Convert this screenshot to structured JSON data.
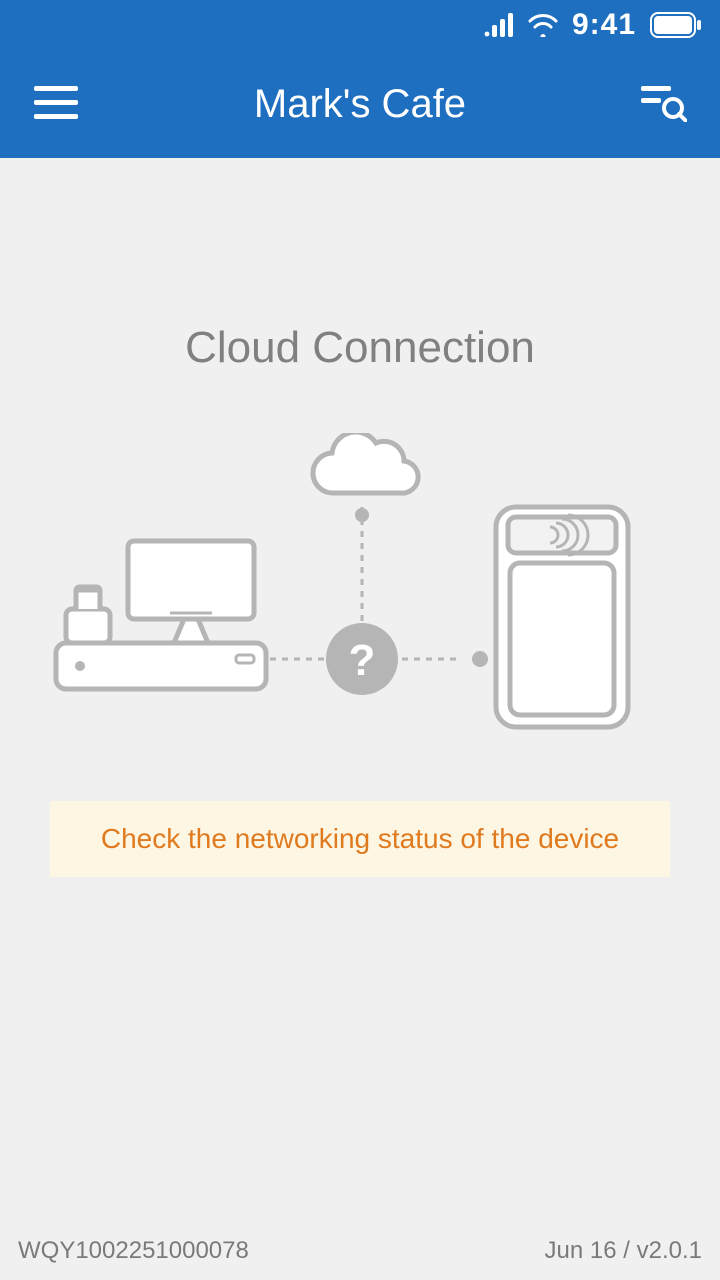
{
  "status_bar": {
    "time": "9:41"
  },
  "header": {
    "title": "Mark's Cafe"
  },
  "main": {
    "section_title": "Cloud Connection",
    "banner_text": "Check the networking status of the device",
    "center_glyph": "?"
  },
  "footer": {
    "device_id": "WQY1002251000078",
    "date_version": "Jun 16 / v2.0.1"
  },
  "colors": {
    "brand_blue": "#1e6fc0",
    "gray_text": "#808080",
    "banner_bg": "#fdf6e3",
    "banner_text": "#e07a1f",
    "diagram_line": "#b5b5b5",
    "diagram_fill": "#ffffff"
  }
}
